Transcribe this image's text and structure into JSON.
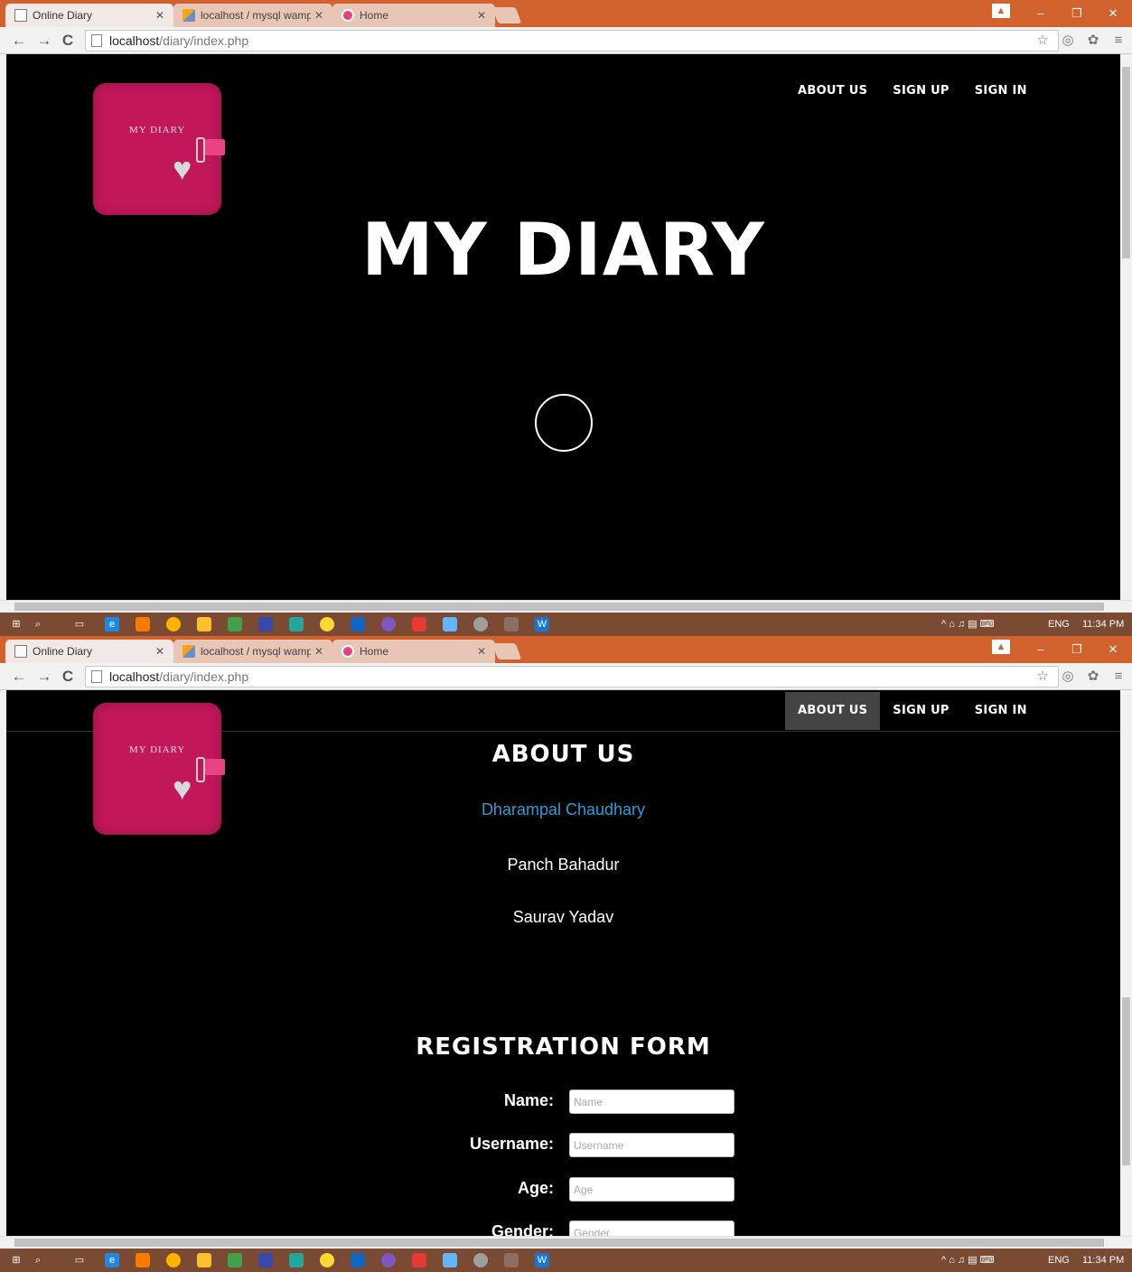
{
  "browser": {
    "tabs": [
      {
        "title": "Online Diary",
        "icon": "document-icon",
        "active": true
      },
      {
        "title": "localhost / mysql wampse",
        "icon": "phpmyadmin-icon",
        "active": false
      },
      {
        "title": "Home",
        "icon": "home-icon",
        "active": false
      }
    ],
    "url_host": "localhost",
    "url_path": "/diary/index.php",
    "window_controls": {
      "minimize": "–",
      "restore": "❐",
      "close": "✕"
    },
    "nav": {
      "back": "←",
      "forward": "→",
      "reload": "C"
    }
  },
  "taskbar": {
    "language": "ENG",
    "time": "11:34 PM",
    "items": [
      "start",
      "search",
      "task-view",
      "edge",
      "app",
      "chrome",
      "files",
      "app",
      "app",
      "app",
      "app",
      "app",
      "app",
      "app",
      "app",
      "app",
      "app",
      "word"
    ]
  },
  "site": {
    "logo_text": "MY DIARY",
    "nav_links": [
      "ABOUT US",
      "SIGN UP",
      "SIGN IN"
    ],
    "hero_title": "MY DIARY",
    "about_title": "ABOUT US",
    "members": [
      "Dharampal Chaudhary",
      "Panch Bahadur",
      "Saurav Yadav"
    ],
    "registration_title": "REGISTRATION FORM",
    "form": {
      "name": {
        "label": "Name:",
        "placeholder": "Name"
      },
      "username": {
        "label": "Username:",
        "placeholder": "Username"
      },
      "age": {
        "label": "Age:",
        "placeholder": "Age"
      },
      "gender": {
        "label": "Gender:",
        "placeholder": "Gender"
      }
    }
  },
  "colors": {
    "chrome_frame": "#d1622d",
    "logo_pink": "#c2185b",
    "link_blue": "#2f9bd6",
    "active_nav": "#444444"
  }
}
